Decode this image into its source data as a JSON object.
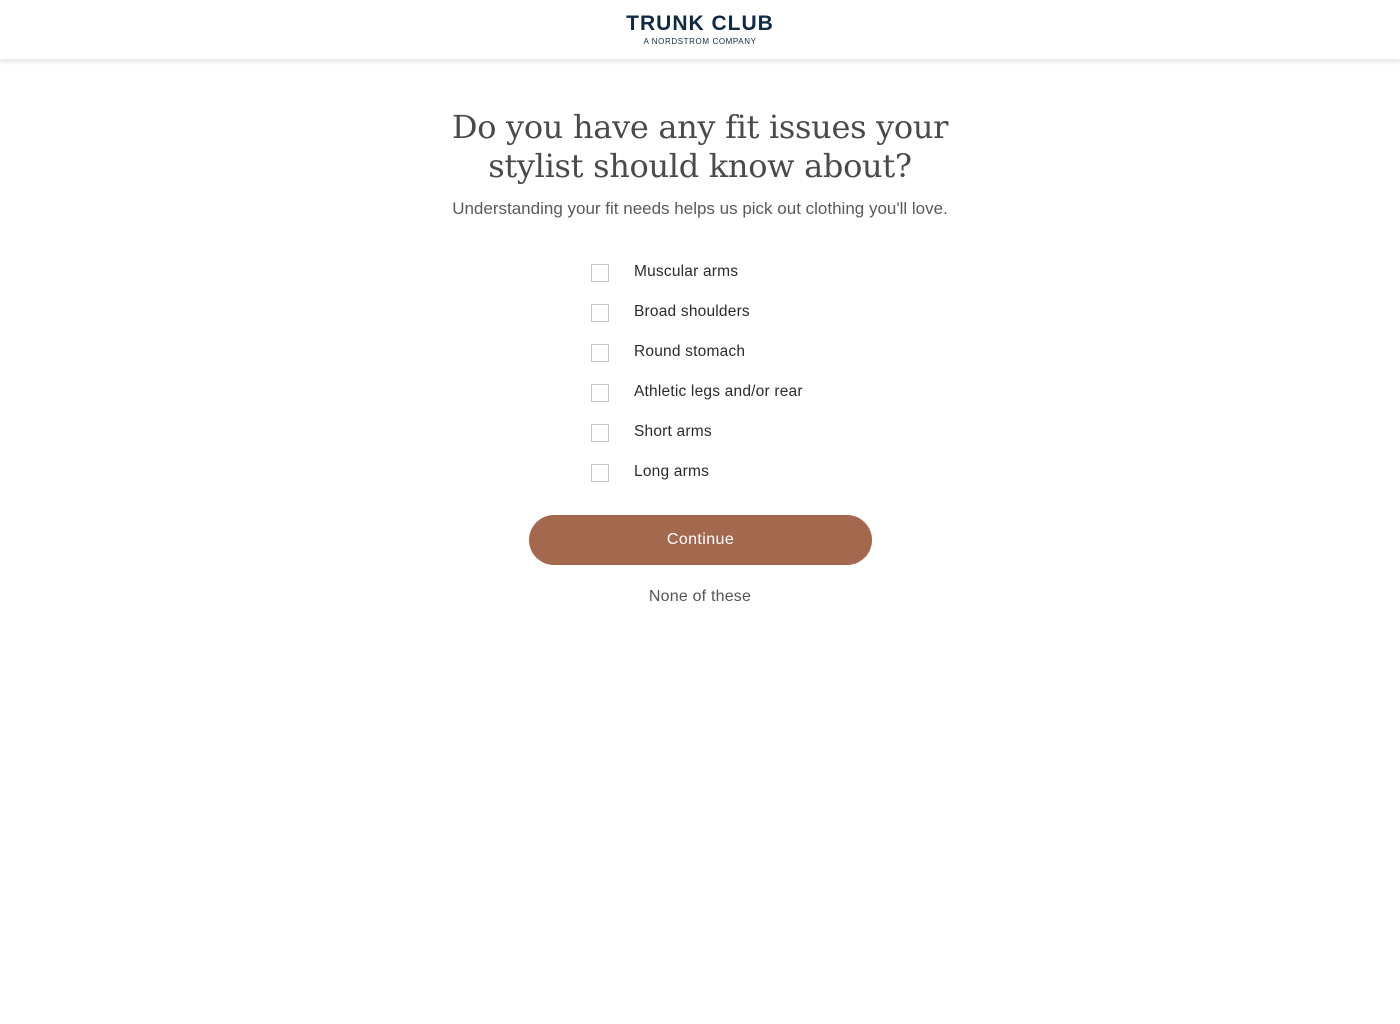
{
  "header": {
    "logo_title": "TRUNK CLUB",
    "logo_subtitle": "A NORDSTROM COMPANY"
  },
  "question": {
    "title": "Do you have any fit issues your stylist should know about?",
    "subtitle": "Understanding your fit needs helps us pick out clothing you'll love."
  },
  "options": [
    {
      "label": "Muscular arms",
      "checked": false
    },
    {
      "label": "Broad shoulders",
      "checked": false
    },
    {
      "label": "Round stomach",
      "checked": false
    },
    {
      "label": "Athletic legs and/or rear",
      "checked": false
    },
    {
      "label": "Short arms",
      "checked": false
    },
    {
      "label": "Long arms",
      "checked": false
    }
  ],
  "actions": {
    "continue_label": "Continue",
    "none_label": "None of these"
  },
  "colors": {
    "brand_navy": "#0f2a44",
    "button_accent": "#a3684d"
  }
}
